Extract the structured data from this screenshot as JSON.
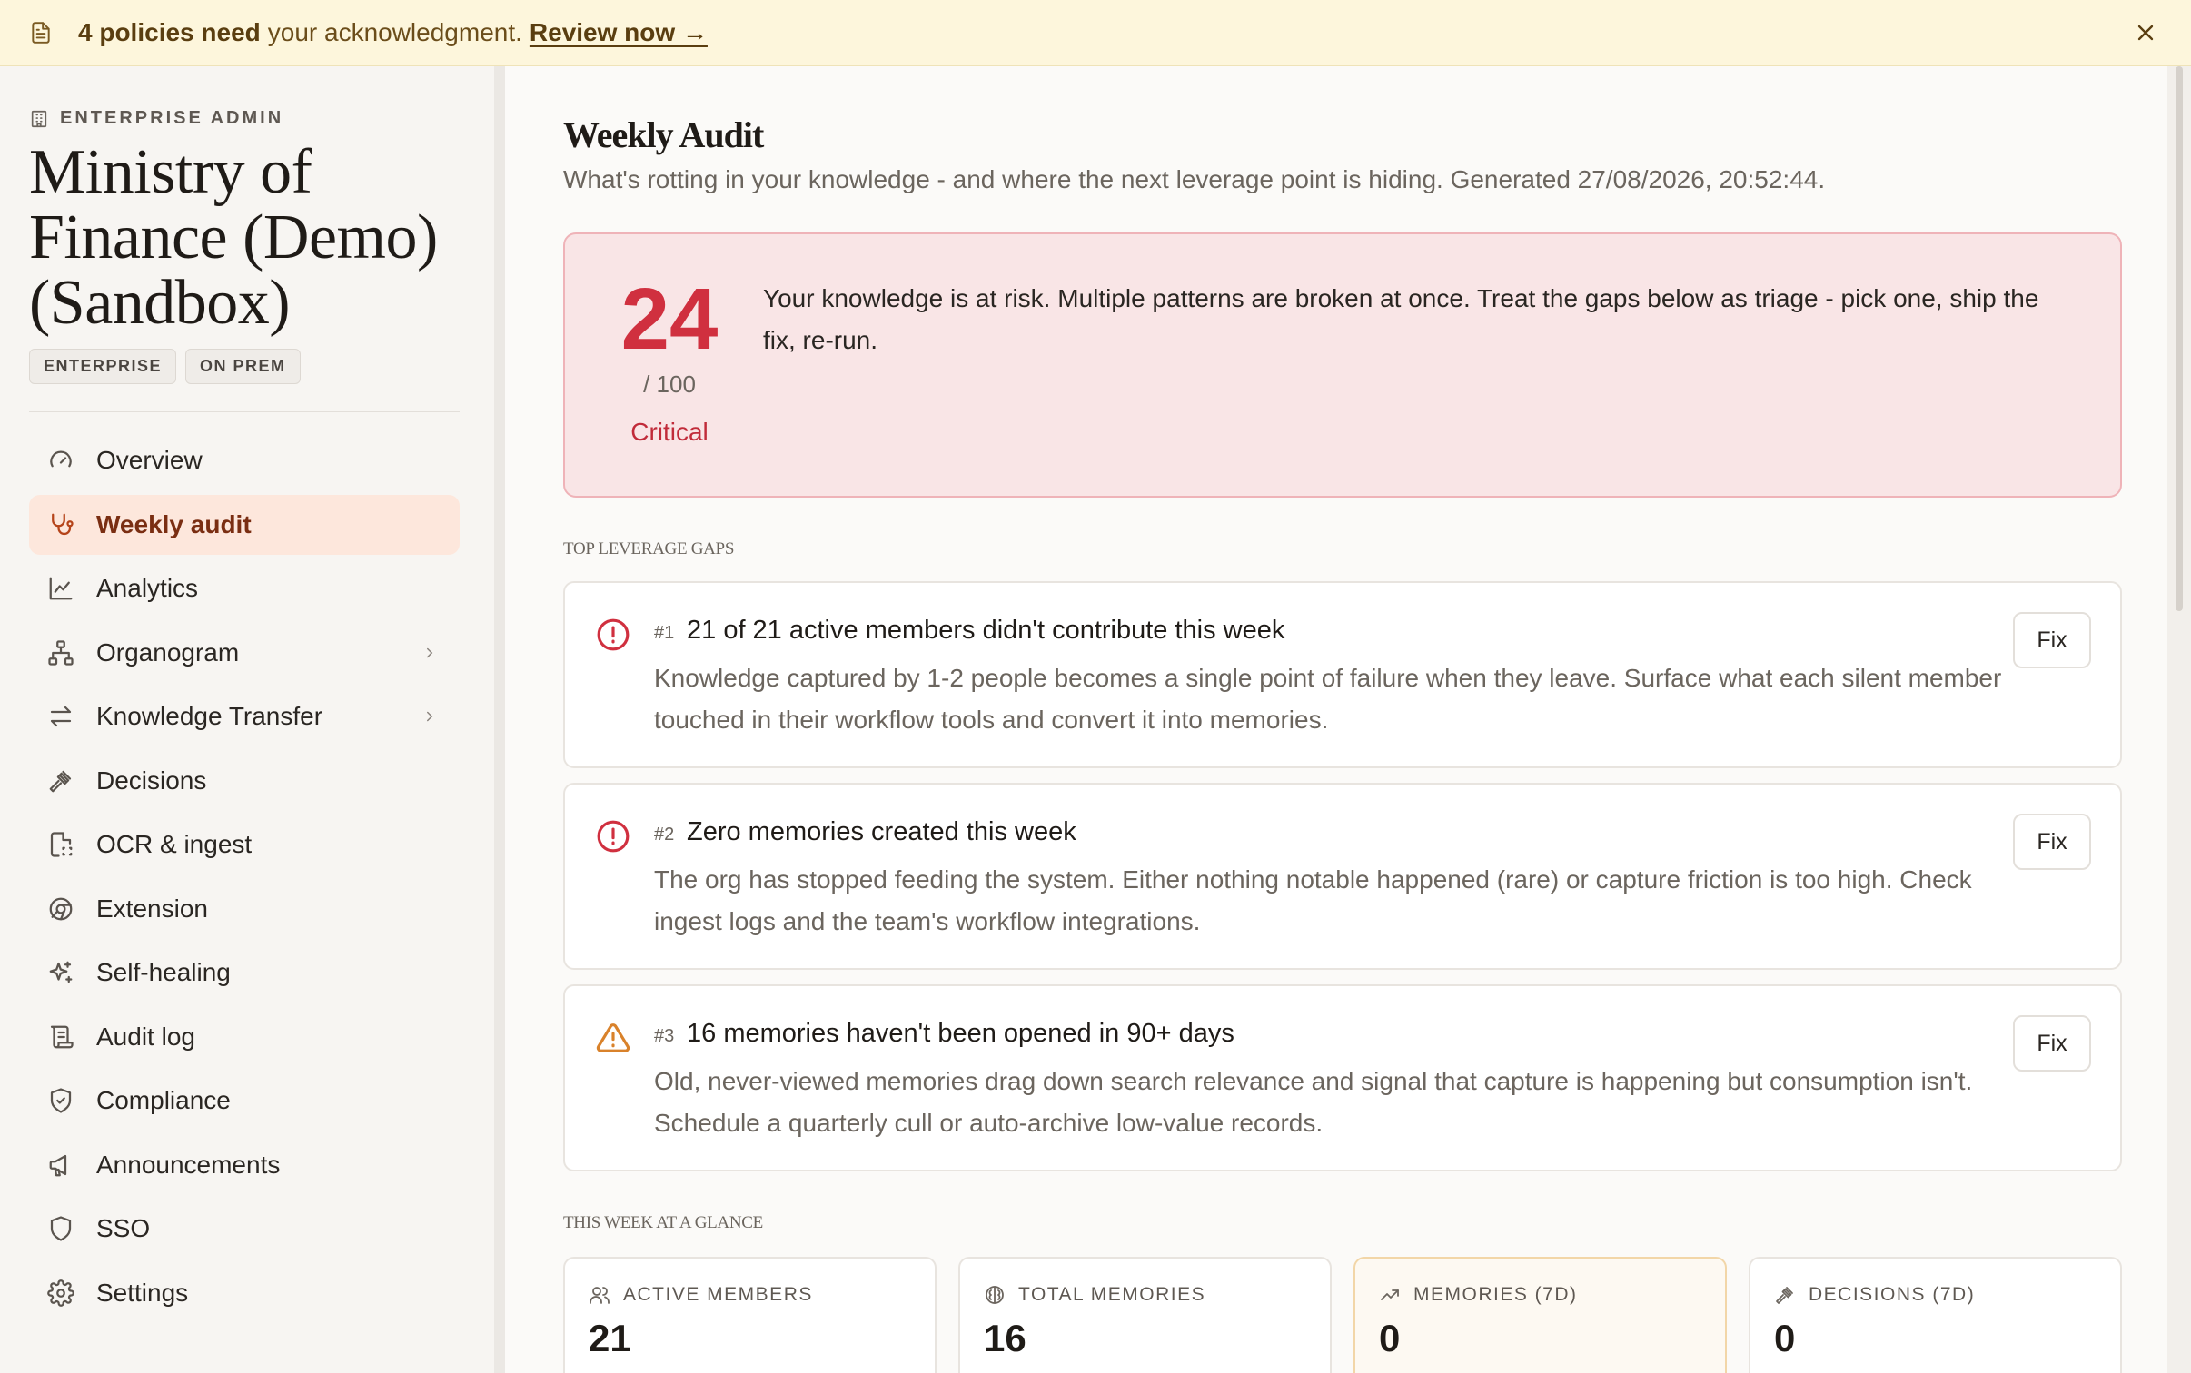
{
  "banner": {
    "bold": "4 policies need",
    "message": "your acknowledgment.",
    "link": "Review now →"
  },
  "sidebar": {
    "eyebrow": "ENTERPRISE ADMIN",
    "org_name": "Ministry of Finance (Demo) (Sandbox)",
    "chips": [
      "ENTERPRISE",
      "ON PREM"
    ],
    "items": [
      {
        "label": "Overview",
        "icon": "gauge-icon"
      },
      {
        "label": "Weekly audit",
        "icon": "stethoscope-icon",
        "active": true
      },
      {
        "label": "Analytics",
        "icon": "line-chart-icon"
      },
      {
        "label": "Organogram",
        "icon": "org-chart-icon",
        "expandable": true
      },
      {
        "label": "Knowledge Transfer",
        "icon": "transfer-arrows-icon",
        "expandable": true
      },
      {
        "label": "Decisions",
        "icon": "gavel-icon"
      },
      {
        "label": "OCR & ingest",
        "icon": "file-scan-icon"
      },
      {
        "label": "Extension",
        "icon": "chrome-icon"
      },
      {
        "label": "Self-healing",
        "icon": "sparkles-icon"
      },
      {
        "label": "Audit log",
        "icon": "scroll-icon"
      },
      {
        "label": "Compliance",
        "icon": "shield-check-icon"
      },
      {
        "label": "Announcements",
        "icon": "megaphone-icon"
      },
      {
        "label": "SSO",
        "icon": "shield-icon"
      },
      {
        "label": "Settings",
        "icon": "gear-icon"
      }
    ]
  },
  "main": {
    "title": "Weekly Audit",
    "subtitle": "What's rotting in your knowledge - and where the next leverage point is hiding. Generated 27/08/2026, 20:52:44.",
    "score": {
      "value": "24",
      "max": "/ 100",
      "label": "Critical",
      "message": "Your knowledge is at risk. Multiple patterns are broken at once. Treat the gaps below as triage - pick one, ship the fix, re-run."
    },
    "gaps_label": "TOP LEVERAGE GAPS",
    "gaps": [
      {
        "rank": "#1",
        "severity": "critical",
        "title": "21 of 21 active members didn't contribute this week",
        "body": "Knowledge captured by 1-2 people becomes a single point of failure when they leave. Surface what each silent member touched in their workflow tools and convert it into memories.",
        "action": "Fix"
      },
      {
        "rank": "#2",
        "severity": "critical",
        "title": "Zero memories created this week",
        "body": "The org has stopped feeding the system. Either nothing notable happened (rare) or capture friction is too high. Check ingest logs and the team's workflow integrations.",
        "action": "Fix"
      },
      {
        "rank": "#3",
        "severity": "warning",
        "title": "16 memories haven't been opened in 90+ days",
        "body": "Old, never-viewed memories drag down search relevance and signal that capture is happening but consumption isn't. Schedule a quarterly cull or auto-archive low-value records.",
        "action": "Fix"
      }
    ],
    "glance_label": "THIS WEEK AT A GLANCE",
    "stats": [
      {
        "label": "ACTIVE MEMBERS",
        "value": "21",
        "icon": "users-icon"
      },
      {
        "label": "TOTAL MEMORIES",
        "value": "16",
        "icon": "brain-icon"
      },
      {
        "label": "MEMORIES (7D)",
        "value": "0",
        "icon": "trend-icon",
        "highlight": true
      },
      {
        "label": "DECISIONS (7D)",
        "value": "0",
        "icon": "gavel-icon"
      }
    ]
  },
  "colors": {
    "critical": "#d0303f",
    "warning": "#d9822b",
    "active_nav_bg": "#fde7dc",
    "banner_bg": "#fdf6dc"
  }
}
